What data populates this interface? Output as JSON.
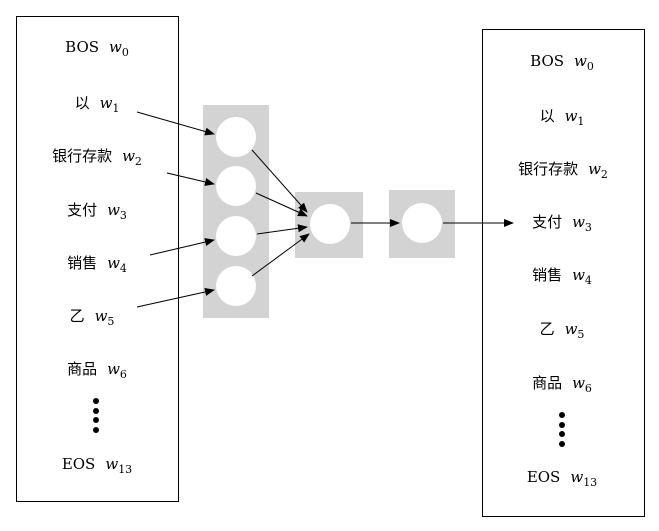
{
  "input_sequence": [
    {
      "token": "BOS",
      "var": "w",
      "sub": "0"
    },
    {
      "token": "以",
      "var": "w",
      "sub": "1"
    },
    {
      "token": "银行存款",
      "var": "w",
      "sub": "2"
    },
    {
      "token": "支付",
      "var": "w",
      "sub": "3"
    },
    {
      "token": "销售",
      "var": "w",
      "sub": "4"
    },
    {
      "token": "乙",
      "var": "w",
      "sub": "5"
    },
    {
      "token": "商品",
      "var": "w",
      "sub": "6"
    },
    {
      "token": "EOS",
      "var": "w",
      "sub": "13"
    }
  ],
  "output_sequence": [
    {
      "token": "BOS",
      "var": "w",
      "sub": "0"
    },
    {
      "token": "以",
      "var": "w",
      "sub": "1"
    },
    {
      "token": "银行存款",
      "var": "w",
      "sub": "2"
    },
    {
      "token": "支付",
      "var": "w",
      "sub": "3"
    },
    {
      "token": "销售",
      "var": "w",
      "sub": "4"
    },
    {
      "token": "乙",
      "var": "w",
      "sub": "5"
    },
    {
      "token": "商品",
      "var": "w",
      "sub": "6"
    },
    {
      "token": "EOS",
      "var": "w",
      "sub": "13"
    }
  ],
  "colors": {
    "panel": "#d3d3d3",
    "node": "#ffffff",
    "edge": "#000000"
  }
}
